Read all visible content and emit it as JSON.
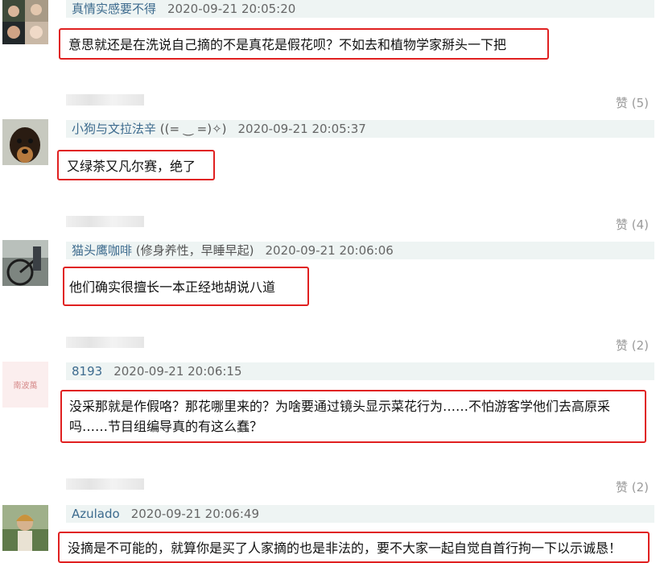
{
  "comments": [
    {
      "user": "真情实感要不得",
      "bio": "",
      "time": "2020-09-21 20:05:20",
      "text": "意思就还是在洗说自己摘的不是真花是假花呗？不如去和植物学家掰头一下把"
    },
    {
      "user": "小狗与文拉法辛",
      "bio": " ((= ‿ =)✧)",
      "time": "2020-09-21 20:05:37",
      "text": "又绿茶又凡尔赛，绝了"
    },
    {
      "user": "猫头鹰咖啡",
      "bio": " (修身养性，早睡早起)",
      "time": "2020-09-21 20:06:06",
      "text": "他们确实很擅长一本正经地胡说八道"
    },
    {
      "user": "8193",
      "bio": "",
      "time": "2020-09-21 20:06:15",
      "text": "没采那就是作假咯？那花哪里来的？为啥要通过镜头显示菜花行为……不怕游客学他们去高原采吗……节目组编导真的有这么蠢？"
    },
    {
      "user": "Azulado",
      "bio": "",
      "time": "2020-09-21 20:06:49",
      "text": "没摘是不可能的，就算你是买了人家摘的也是非法的，要不大家一起自觉自首行拘一下以示诚恳！"
    }
  ],
  "likes": [
    "赞 (5)",
    "赞 (4)",
    "赞 (2)",
    "赞 (2)"
  ],
  "avatar4_text": "南波萬"
}
